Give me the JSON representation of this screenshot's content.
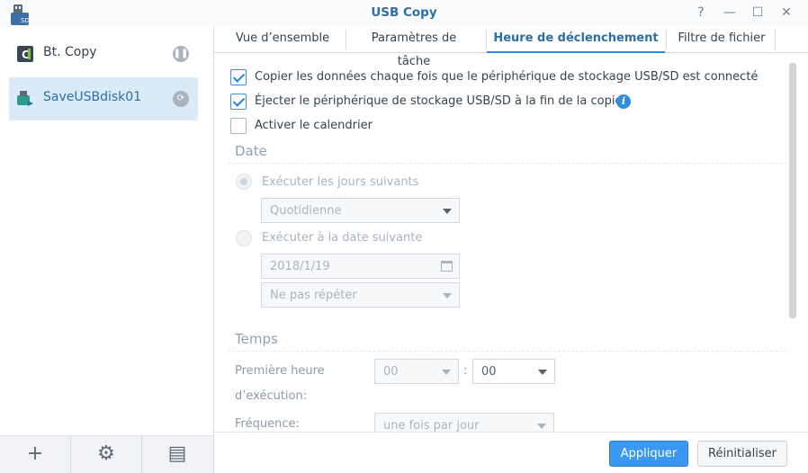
{
  "window": {
    "title": "USB Copy",
    "controls": {
      "help": "?",
      "minimize": "—",
      "maximize": "☐",
      "close": "✕"
    }
  },
  "sidebar": {
    "items": [
      {
        "label": "Bt. Copy",
        "icon": "copy-task-icon",
        "status_icon": "pause-icon",
        "status_glyph": "❚❚"
      },
      {
        "label": "SaveUSBdisk01",
        "icon": "usb-task-icon",
        "status_icon": "link-icon",
        "status_glyph": "⟳",
        "selected": true
      }
    ],
    "toolbar": {
      "add": "+",
      "settings": "⚙",
      "log": "▤"
    }
  },
  "tabs": [
    {
      "label": "Vue d’ensemble"
    },
    {
      "label": "Paramètres de tâche"
    },
    {
      "label": "Heure de déclenchement",
      "active": true
    },
    {
      "label": "Filtre de fichier"
    }
  ],
  "trigger": {
    "copy_on_connect": {
      "label": "Copier les données chaque fois que le périphérique de stockage USB/SD est connecté",
      "checked": true
    },
    "eject_after_copy": {
      "label": "Éjecter le périphérique de stockage USB/SD à la fin de la copie",
      "checked": true,
      "info": "i"
    },
    "enable_schedule": {
      "label": "Activer le calendrier",
      "checked": false
    }
  },
  "date_section": {
    "title": "Date",
    "run_days": {
      "label": "Exécuter les jours suivants",
      "selected": true,
      "value": "Quotidienne"
    },
    "run_date": {
      "label": "Exécuter à la date suivante",
      "selected": false,
      "date": "2018/1/19",
      "repeat": "Ne pas répéter"
    }
  },
  "time_section": {
    "title": "Temps",
    "first_time_label_1": "Première heure",
    "first_time_label_2": "d’exécution:",
    "hour": "00",
    "minute": "00",
    "separator": ":",
    "frequency_label": "Fréquence:",
    "frequency": "une fois par jour"
  },
  "footer": {
    "apply": "Appliquer",
    "reset": "Réinitialiser"
  },
  "colors": {
    "accent": "#2d8adf",
    "primary_button": "#3a97f2",
    "selected_item": "#dbeaf7",
    "section_title": "#8fa3b6"
  }
}
